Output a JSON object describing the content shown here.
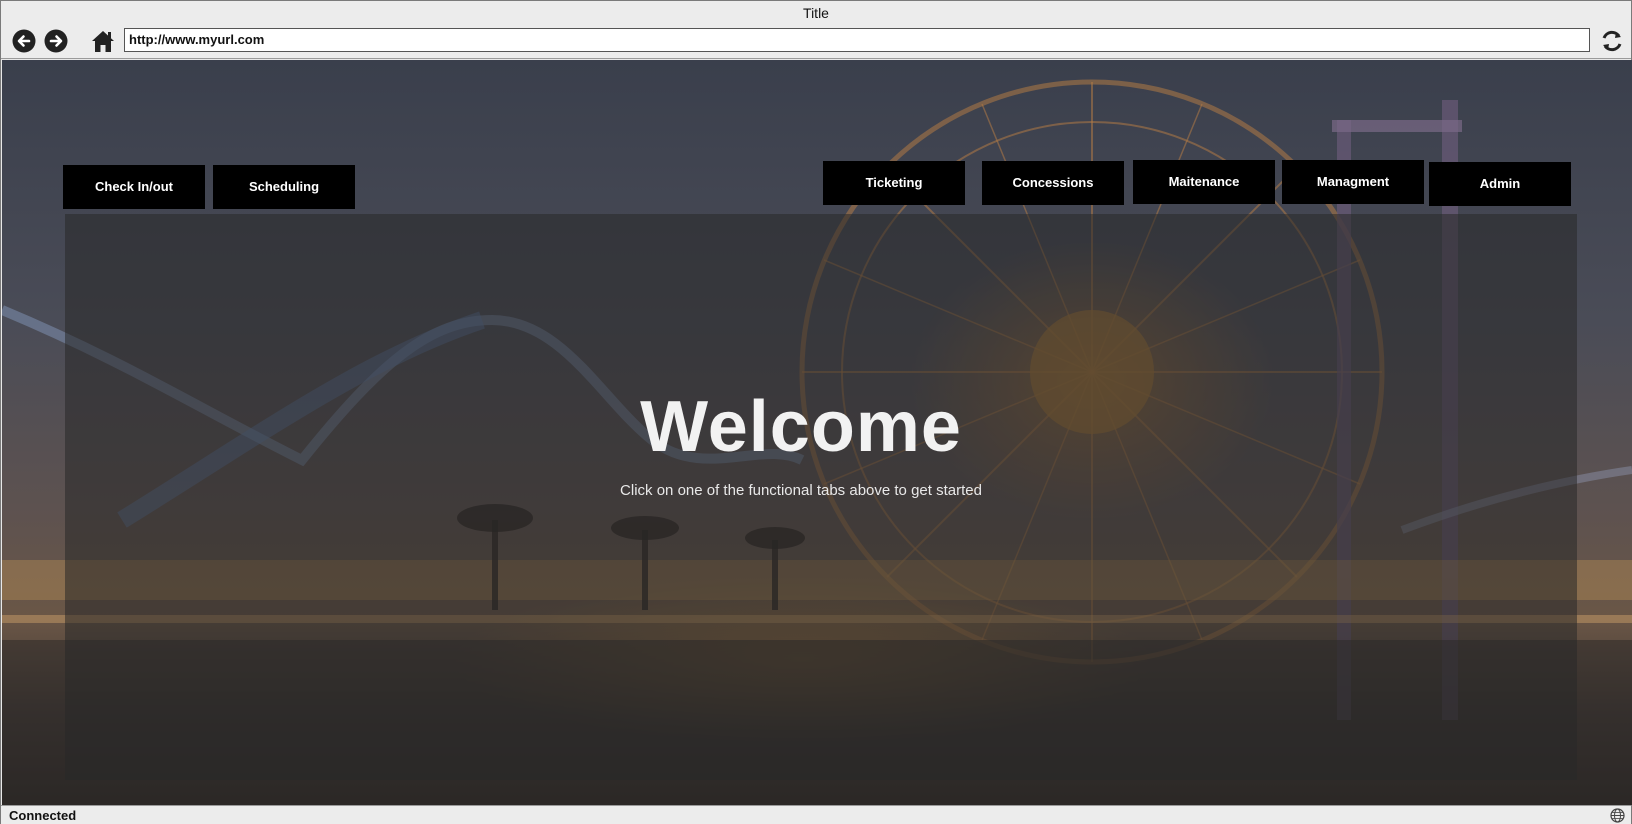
{
  "window": {
    "title": "Title"
  },
  "toolbar": {
    "url": "http://www.myurl.com",
    "back_icon": "back-arrow-icon",
    "forward_icon": "forward-arrow-icon",
    "home_icon": "home-icon",
    "refresh_icon": "refresh-icon"
  },
  "tabs": {
    "left": [
      {
        "label": "Check In/out"
      },
      {
        "label": "Scheduling"
      }
    ],
    "right": [
      {
        "label": "Ticketing"
      },
      {
        "label": "Concessions"
      },
      {
        "label": "Maitenance"
      },
      {
        "label": "Managment"
      },
      {
        "label": "Admin"
      }
    ]
  },
  "main": {
    "heading": "Welcome",
    "subheading": "Click on one of the functional tabs above to get started"
  },
  "status": {
    "text": "Connected",
    "icon": "globe-icon"
  },
  "colors": {
    "tab_bg": "#000000",
    "tab_text": "#ffffff",
    "chrome": "#ececec"
  }
}
